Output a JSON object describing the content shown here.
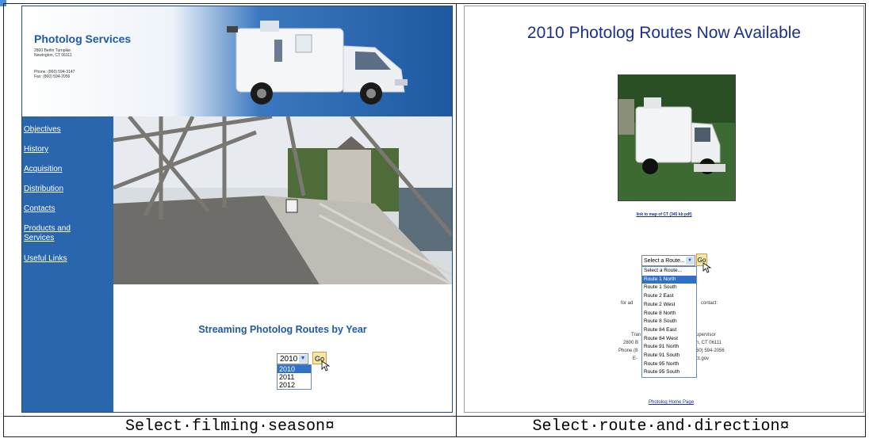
{
  "left": {
    "company": "Photolog Services",
    "address": [
      "2800 Berlin Turnpike",
      "Newington, CT 06111"
    ],
    "phone": [
      "Phone: (860) 594-3147",
      "Fax:    (860) 594-2056"
    ],
    "nav": [
      "Objectives",
      "History",
      "Acquisition",
      "Distribution",
      "Contacts",
      "Products and Services",
      "Useful Links"
    ],
    "heading": "Streaming Photolog Routes by Year",
    "select_value": "2010",
    "go_label": "Go",
    "options": [
      "2010",
      "2011",
      "2012"
    ],
    "caption": "Select·filming·season¤"
  },
  "right": {
    "heading": "2010 Photolog Routes Now Available",
    "map_link": "link to map of CT (345 kb pdf)",
    "select_value": "Select a Route...",
    "go_label": "Go",
    "options": [
      "Select a Route...",
      "Route 1 North",
      "Route 1 South",
      "Route 2 East",
      "Route 2 West",
      "Route 8 North",
      "Route 8 South",
      "Route 84 East",
      "Route 84 West",
      "Route 91 North",
      "Route 91 South",
      "Route 95 North",
      "Route 95 South"
    ],
    "bg_text": {
      "for_ad": "for ad",
      "contact": "contact:",
      "tran": "Tran",
      "supervisor": "upervisor",
      "addr_left": "2800 B",
      "addr_right": "n, CT 06111",
      "phone_left": "Phone (8",
      "phone_right": "60) 594-2056",
      "e_left": "E-",
      "e_right": "ct.gov",
      "home_link": "Photolog Home Page"
    },
    "caption": "Select·route·and·direction¤"
  },
  "colors": {
    "accent": "#2a66ad",
    "title_blue": "#1f5aa6",
    "heading_navy": "#1c2f8c"
  }
}
